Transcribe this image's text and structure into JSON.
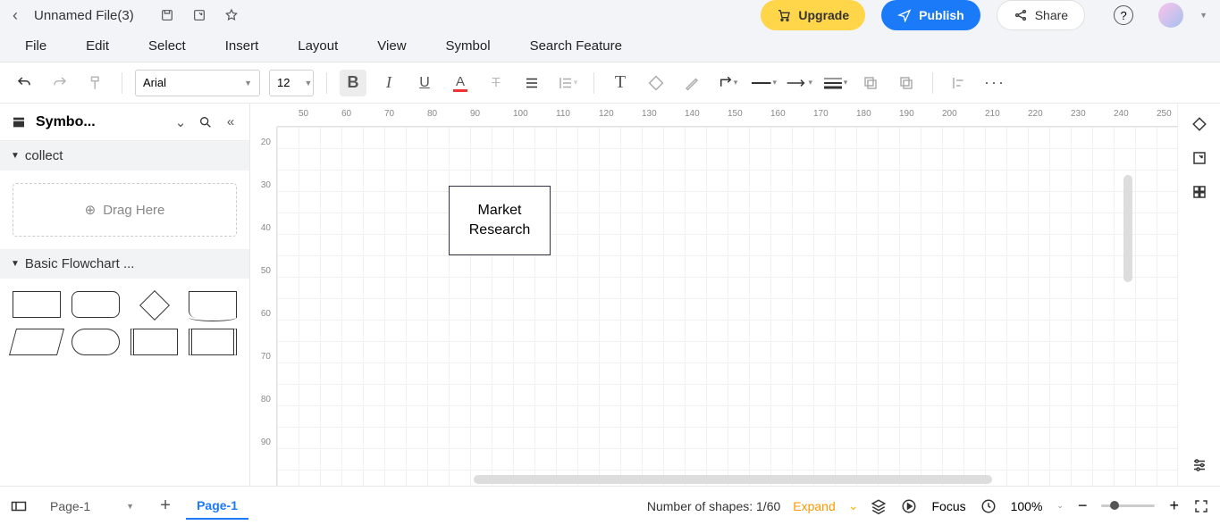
{
  "title": "Unnamed File(3)",
  "menus": [
    "File",
    "Edit",
    "Select",
    "Insert",
    "Layout",
    "View",
    "Symbol",
    "Search Feature"
  ],
  "buttons": {
    "upgrade": "Upgrade",
    "publish": "Publish",
    "share": "Share"
  },
  "toolbar": {
    "font": "Arial",
    "size": "12"
  },
  "leftpanel": {
    "title": "Symbo...",
    "section_collect": "collect",
    "drag_here": "Drag Here",
    "section_flowchart": "Basic Flowchart ..."
  },
  "ruler_h": [
    "50",
    "60",
    "70",
    "80",
    "90",
    "100",
    "110",
    "120",
    "130",
    "140",
    "150",
    "160",
    "170",
    "180",
    "190",
    "200",
    "210",
    "220",
    "230",
    "240",
    "250"
  ],
  "ruler_v": [
    "20",
    "30",
    "40",
    "50",
    "60",
    "70",
    "80",
    "90"
  ],
  "canvas": {
    "node_text": "Market\nResearch"
  },
  "bottombar": {
    "page_dd": "Page-1",
    "page_tab": "Page-1",
    "shapes_label": "Number of shapes: 1/60",
    "expand": "Expand",
    "focus": "Focus",
    "zoom": "100%"
  }
}
